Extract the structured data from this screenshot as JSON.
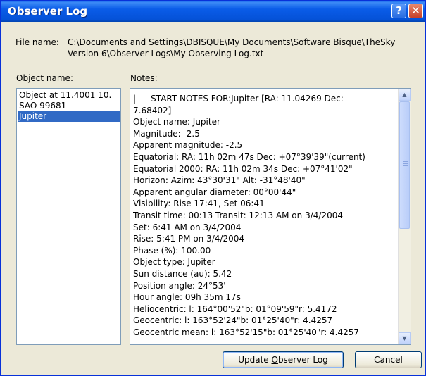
{
  "window": {
    "title": "Observer Log",
    "help_glyph": "?",
    "close_glyph": "✕"
  },
  "file": {
    "label": "File name:",
    "path_line1": "C:\\Documents and Settings\\DBISQUE\\My Documents\\Software Bisque\\TheSky",
    "path_line2": "Version 6\\Observer Logs\\My Observing Log.txt"
  },
  "object_list": {
    "label": "Object name:",
    "items": [
      "Object at  11.4001  10.",
      "SAO 99681",
      "Jupiter"
    ],
    "selected_index": 2
  },
  "notes": {
    "label": "Notes:",
    "lines": [
      "|---- START NOTES FOR:Jupiter  [RA:  11.04269 Dec:",
      "7.68402]",
      "Object name: Jupiter",
      "Magnitude: -2.5",
      "Apparent magnitude: -2.5",
      "Equatorial: RA: 11h 02m 47s   Dec: +07°39'39\"(current)",
      "Equatorial 2000: RA: 11h 02m 34s   Dec: +07°41'02\"",
      "Horizon: Azim: 43°30'31\"   Alt: -31°48'40\"",
      "Apparent angular diameter: 00°00'44\"",
      "Visibility: Rise 17:41,  Set 06:41",
      "Transit time: 00:13  Transit: 12:13 AM on 3/4/2004",
      "Set: 6:41 AM on 3/4/2004",
      "Rise: 5:41 PM on 3/4/2004",
      "Phase (%): 100.00",
      "Object type: Jupiter",
      "Sun distance (au): 5.42",
      "Position angle: 24°53'",
      "Hour angle: 09h 35m 17s",
      "Heliocentric: l: 164°00'52\"b: 01°09'59\"r: 5.4172",
      "Geocentric: l: 163°52'24\"b: 01°25'40\"r: 4.4257",
      "Geocentric mean: l: 163°52'15\"b: 01°25'40\"r: 4.4257"
    ]
  },
  "scrollbar": {
    "up_glyph": "▲",
    "down_glyph": "▼"
  },
  "buttons": {
    "update_label": "Update Observer Log",
    "cancel_label": "Cancel"
  }
}
